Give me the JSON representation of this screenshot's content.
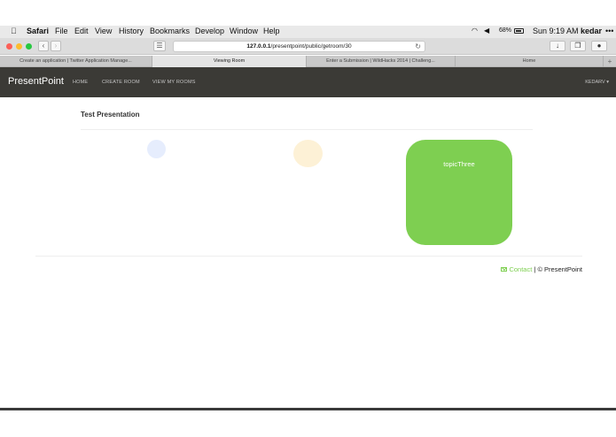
{
  "menubar": {
    "apple_glyph": "",
    "items": [
      "Safari",
      "File",
      "Edit",
      "View",
      "History",
      "Bookmarks",
      "Develop",
      "Window",
      "Help"
    ],
    "battery": "68%",
    "clock": "Sun 9:19 AM",
    "user": "kedar",
    "more": "•••"
  },
  "browser": {
    "url_host": "127.0.0.1",
    "url_path": "/presentpoint/public/getroom/30",
    "tabs": [
      "Create an application | Twitter Application Manage...",
      "Viewing Room",
      "Enter a Submission | WildHacks 2014 | Challeng...",
      "Home"
    ],
    "active_tab": 1,
    "new_tab": "+"
  },
  "app": {
    "brand": "PresentPoint",
    "nav": {
      "home": "HOME",
      "create_room": "CREATE ROOM",
      "view_rooms": "VIEW MY ROOMS",
      "user": "KEDARV ▾"
    },
    "presentation_title": "Test Presentation",
    "topic_card_label": "topicThree",
    "footer": {
      "contact": "Contact",
      "copyright": " | © PresentPoint"
    }
  },
  "colors": {
    "navbar": "#3b3a36",
    "accent_green": "#7ecf51",
    "bubble_blue": "#e6edfd",
    "bubble_yellow": "#fdf1d6"
  }
}
